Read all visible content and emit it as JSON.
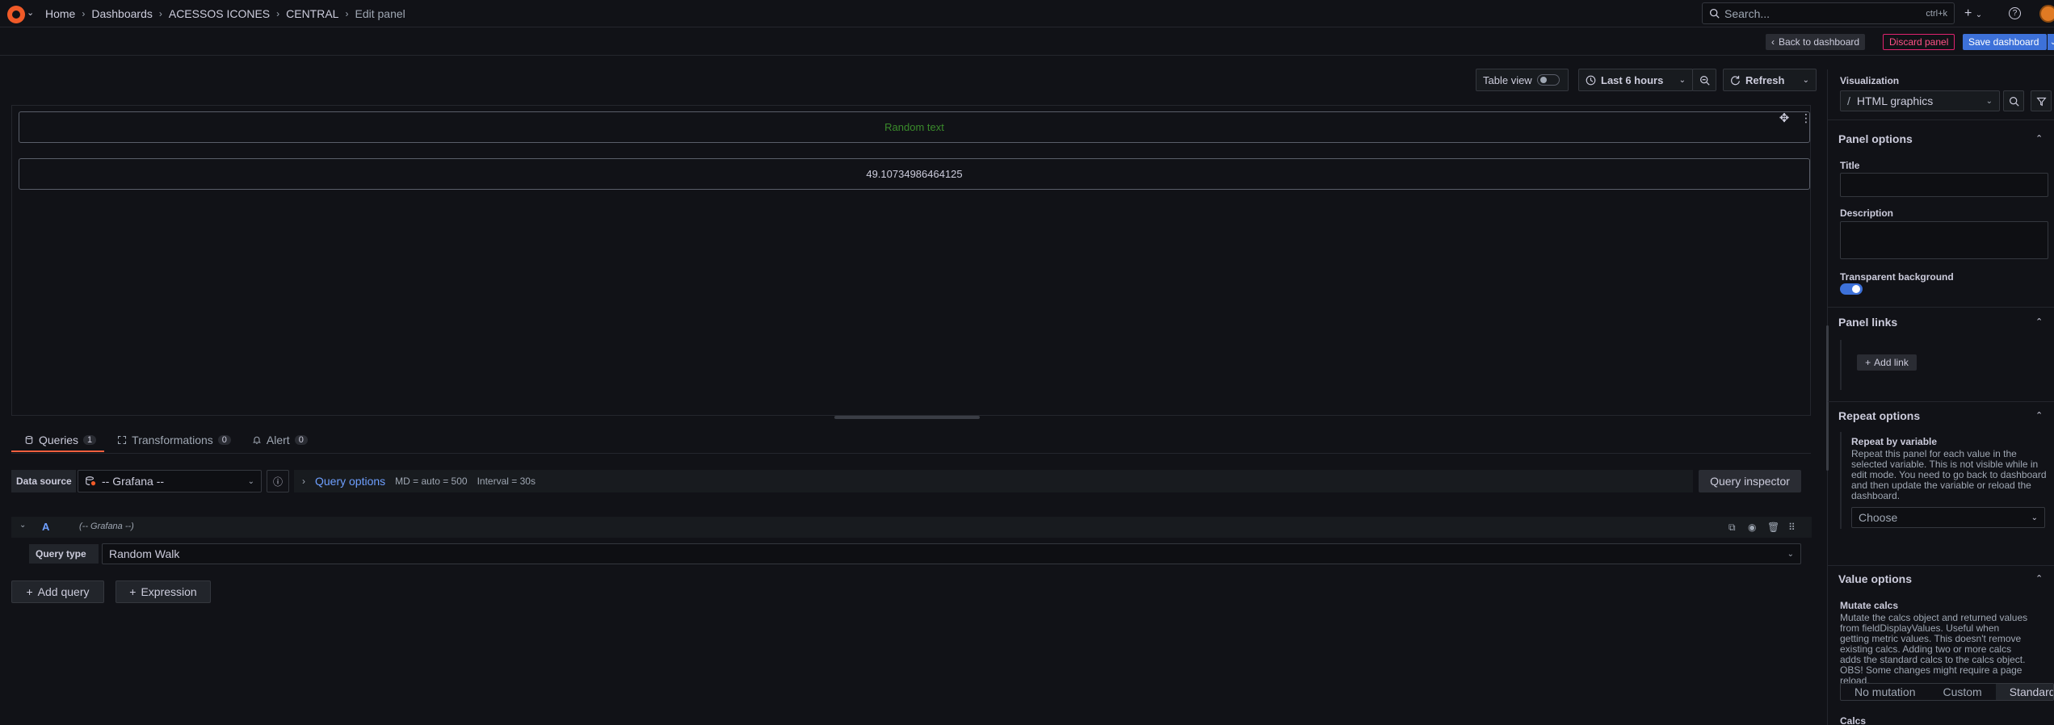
{
  "breadcrumb": [
    "Home",
    "Dashboards",
    "ACESSOS ICONES",
    "CENTRAL",
    "Edit panel"
  ],
  "search": {
    "placeholder": "Search...",
    "shortcut": "ctrl+k"
  },
  "actions": {
    "back": "Back to dashboard",
    "discard": "Discard panel",
    "save": "Save dashboard"
  },
  "toolbar": {
    "table_view": "Table view",
    "time_range": "Last 6 hours",
    "refresh": "Refresh"
  },
  "panel": {
    "text_box": "Random text",
    "value_box": "49.10734986464125",
    "text_color": "#3a8a2b"
  },
  "tabs": [
    {
      "label": "Queries",
      "count": "1"
    },
    {
      "label": "Transformations",
      "count": "0"
    },
    {
      "label": "Alert",
      "count": "0"
    }
  ],
  "query_editor": {
    "data_source_label": "Data source",
    "data_source": "-- Grafana --",
    "query_options_label": "Query options",
    "md": "MD = auto = 500",
    "interval": "Interval = 30s",
    "inspector": "Query inspector",
    "query": {
      "ref": "A",
      "datasource": "(-- Grafana --)",
      "query_type_label": "Query type",
      "query_type": "Random Walk"
    },
    "add_query": "Add query",
    "expression": "Expression"
  },
  "sidebar": {
    "visualization_label": "Visualization",
    "visualization": "HTML graphics",
    "panel_options": {
      "title": "Panel options",
      "title_label": "Title",
      "description_label": "Description",
      "transparent_label": "Transparent background",
      "transparent": true
    },
    "panel_links": {
      "title": "Panel links",
      "add_link": "Add link"
    },
    "repeat_options": {
      "title": "Repeat options",
      "repeat_label": "Repeat by variable",
      "description": "Repeat this panel for each value in the selected variable. This is not visible while in edit mode. You need to go back to dashboard and then update the variable or reload the dashboard.",
      "select_placeholder": "Choose"
    },
    "value_options": {
      "title": "Value options",
      "mutate_label": "Mutate calcs",
      "mutate_description": "Mutate the calcs object and returned values from fieldDisplayValues. Useful when getting metric values. This doesn't remove existing calcs. Adding two or more calcs adds the standard calcs to the calcs object. OBS! Some changes might require a page reload.",
      "mutate_options": [
        "No mutation",
        "Custom",
        "Standard calcs"
      ],
      "mutate_selected": "Standard calcs",
      "calcs_label": "Calcs"
    }
  },
  "colors": {
    "accent": "#3d71d9",
    "discard": "#ff5286",
    "tab_active": "#f55f3e",
    "brand": "#f05a28"
  }
}
